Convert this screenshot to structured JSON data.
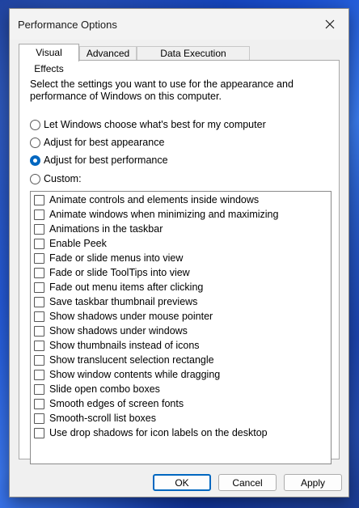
{
  "window": {
    "title": "Performance Options"
  },
  "tabs": [
    "Visual Effects",
    "Advanced",
    "Data Execution Prevention"
  ],
  "description": "Select the settings you want to use for the appearance and performance of Windows on this computer.",
  "radios": [
    {
      "label": "Let Windows choose what's best for my computer",
      "checked": false
    },
    {
      "label": "Adjust for best appearance",
      "checked": false
    },
    {
      "label": "Adjust for best performance",
      "checked": true
    },
    {
      "label": "Custom:",
      "checked": false
    }
  ],
  "effects": [
    "Animate controls and elements inside windows",
    "Animate windows when minimizing and maximizing",
    "Animations in the taskbar",
    "Enable Peek",
    "Fade or slide menus into view",
    "Fade or slide ToolTips into view",
    "Fade out menu items after clicking",
    "Save taskbar thumbnail previews",
    "Show shadows under mouse pointer",
    "Show shadows under windows",
    "Show thumbnails instead of icons",
    "Show translucent selection rectangle",
    "Show window contents while dragging",
    "Slide open combo boxes",
    "Smooth edges of screen fonts",
    "Smooth-scroll list boxes",
    "Use drop shadows for icon labels on the desktop"
  ],
  "buttons": {
    "ok": "OK",
    "cancel": "Cancel",
    "apply": "Apply"
  },
  "colors": {
    "accent": "#0067c0",
    "dialog_bg": "#f0f0f0"
  }
}
